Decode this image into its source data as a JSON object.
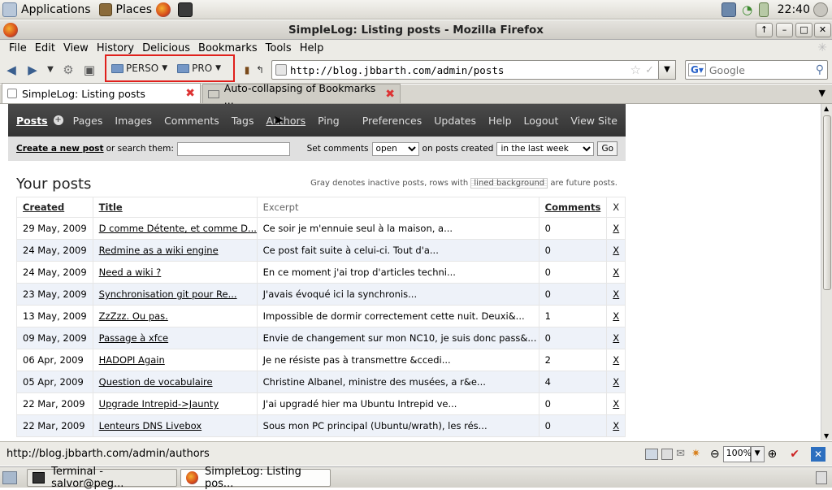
{
  "panel": {
    "applications": "Applications",
    "places": "Places",
    "clock": "22:40"
  },
  "window": {
    "title": "SimpleLog: Listing posts - Mozilla Firefox"
  },
  "menu": [
    "File",
    "Edit",
    "View",
    "History",
    "Delicious",
    "Bookmarks",
    "Tools",
    "Help"
  ],
  "toolbar": {
    "bookmark_folders": [
      "PERSO",
      "PRO"
    ],
    "highlight_color": "#e0201c"
  },
  "url": {
    "value": "http://blog.jbbarth.com/admin/posts"
  },
  "search": {
    "placeholder": "Google"
  },
  "tabs": [
    {
      "label": "SimpleLog: Listing posts"
    },
    {
      "label": "Auto-collapsing of Bookmarks ..."
    }
  ],
  "site": {
    "nav": [
      "Posts",
      "Pages",
      "Images",
      "Comments",
      "Tags",
      "Authors",
      "Ping"
    ],
    "nav_right": [
      "Preferences",
      "Updates",
      "Help",
      "Logout",
      "View Site"
    ],
    "create_link": "Create a new post",
    "or_search": "or search them:",
    "set_comments": "Set comments",
    "comments_value": "open",
    "on_posts_created": "on posts created",
    "created_value": "in the last week",
    "go": "Go",
    "heading": "Your posts",
    "gray_note_1": "Gray denotes inactive posts, rows with",
    "gray_note_lined": "lined background",
    "gray_note_2": "are future posts."
  },
  "table": {
    "headers": [
      "Created",
      "Title",
      "Excerpt",
      "Comments",
      "X"
    ],
    "rows": [
      [
        "29 May, 2009",
        "D comme Détente, et comme D...",
        "Ce soir je m'ennuie seul à la maison, a...",
        "0",
        "X"
      ],
      [
        "24 May, 2009",
        "Redmine as a wiki engine",
        "Ce post fait suite à celui-ci. Tout d'a...",
        "0",
        "X"
      ],
      [
        "24 May, 2009",
        "Need a wiki ?",
        "En ce moment j'ai trop d'articles techni...",
        "0",
        "X"
      ],
      [
        "23 May, 2009",
        "Synchronisation git pour Re...",
        "J'avais évoqué ici la synchronis...",
        "0",
        "X"
      ],
      [
        "13 May, 2009",
        "ZzZzz. Ou pas.",
        "Impossible de dormir correctement cette nuit. Deuxi&...",
        "1",
        "X"
      ],
      [
        "09 May, 2009",
        "Passage à xfce",
        "Envie de changement sur mon NC10, je suis donc pass&...",
        "0",
        "X"
      ],
      [
        "06 Apr, 2009",
        "HADOPI Again",
        "Je ne résiste pas à transmettre &ccedi...",
        "2",
        "X"
      ],
      [
        "05 Apr, 2009",
        "Question de vocabulaire",
        "Christine Albanel, ministre des musées, a r&e...",
        "4",
        "X"
      ],
      [
        "22 Mar, 2009",
        "Upgrade Intrepid->Jaunty",
        "J'ai upgradé hier ma Ubuntu Intrepid ve...",
        "0",
        "X"
      ],
      [
        "22 Mar, 2009",
        "Lenteurs DNS Livebox",
        "Sous mon PC principal (Ubuntu/wrath), les rés...",
        "0",
        "X"
      ]
    ]
  },
  "status": {
    "text": "http://blog.jbbarth.com/admin/authors",
    "zoom": "100%"
  },
  "taskbar": [
    {
      "label": "Terminal - salvor@peg..."
    },
    {
      "label": "SimpleLog: Listing pos..."
    }
  ]
}
